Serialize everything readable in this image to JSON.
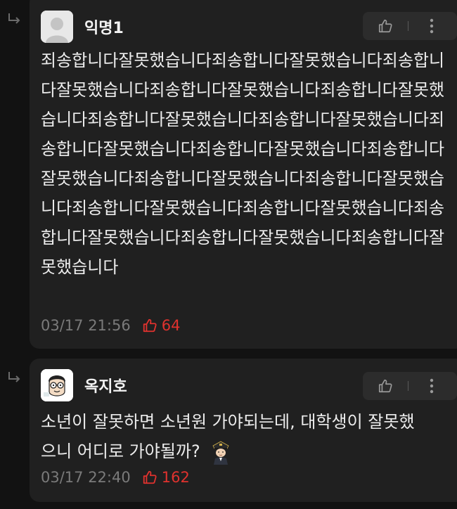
{
  "comments": [
    {
      "author": "익명1",
      "body": "죄송합니다잘못했습니다죄송합니다잘못했습니다죄송합니다잘못했습니다죄송합니다잘못했습니다죄송합니다잘못했습니다죄송합니다잘못했습니다죄송합니다잘못했습니다죄송합니다잘못했습니다죄송합니다잘못했습니다죄송합니다잘못했습니다죄송합니다잘못했습니다죄송합니다잘못했습니다죄송합니다잘못했습니다죄송합니다잘못했습니다죄송합니다잘못했습니다죄송합니다잘못했습니다죄송합니다잘못했습니다",
      "time": "03/17 21:56",
      "likes": "64"
    },
    {
      "author": "옥지호",
      "body": "소년이 잘못하면 소년원 가야되는데, 대학생이 잘못했으니 어디로 가야될까?",
      "time": "03/17 22:40",
      "likes": "162"
    }
  ],
  "colors": {
    "background": "#121212",
    "card": "#202020",
    "like": "#e0322e",
    "meta": "#7a7a7a"
  },
  "icons": [
    "reply-arrow-icon",
    "thumbs-up-icon",
    "more-vertical-icon",
    "default-avatar-icon",
    "police-emoji-icon"
  ]
}
